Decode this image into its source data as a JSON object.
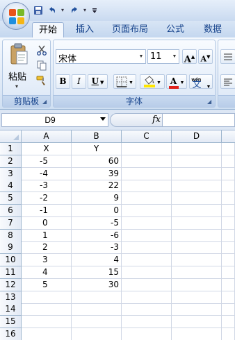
{
  "qat": {
    "icons": [
      "save-icon",
      "undo-icon",
      "redo-icon",
      "customize-icon"
    ]
  },
  "tabs": [
    "开始",
    "插入",
    "页面布局",
    "公式",
    "数据"
  ],
  "ribbon": {
    "clipboard": {
      "paste_label": "粘贴",
      "group_label": "剪贴板"
    },
    "font": {
      "name": "宋体",
      "size": "11",
      "group_label": "字体",
      "bold": "B",
      "italic": "I",
      "underline": "U",
      "grow": "A",
      "shrink": "A",
      "phonetic_top": "wén",
      "phonetic_main": "文",
      "font_color_glyph": "A"
    },
    "colors": {
      "font_color": "#e0211b",
      "fill_color": "#ffe600"
    }
  },
  "formula_bar": {
    "name_box": "D9",
    "fx": "fx",
    "formula": ""
  },
  "grid": {
    "columns": [
      "A",
      "B",
      "C",
      "D"
    ],
    "rows": [
      {
        "n": "1",
        "a": "X",
        "b": "Y"
      },
      {
        "n": "2",
        "a": "-5",
        "b": "60"
      },
      {
        "n": "3",
        "a": "-4",
        "b": "39"
      },
      {
        "n": "4",
        "a": "-3",
        "b": "22"
      },
      {
        "n": "5",
        "a": "-2",
        "b": "9"
      },
      {
        "n": "6",
        "a": "-1",
        "b": "0"
      },
      {
        "n": "7",
        "a": "0",
        "b": "-5"
      },
      {
        "n": "8",
        "a": "1",
        "b": "-6"
      },
      {
        "n": "9",
        "a": "2",
        "b": "-3"
      },
      {
        "n": "10",
        "a": "3",
        "b": "4"
      },
      {
        "n": "11",
        "a": "4",
        "b": "15"
      },
      {
        "n": "12",
        "a": "5",
        "b": "30"
      },
      {
        "n": "13",
        "a": "",
        "b": ""
      },
      {
        "n": "14",
        "a": "",
        "b": ""
      },
      {
        "n": "15",
        "a": "",
        "b": ""
      },
      {
        "n": "16",
        "a": "",
        "b": ""
      }
    ]
  }
}
